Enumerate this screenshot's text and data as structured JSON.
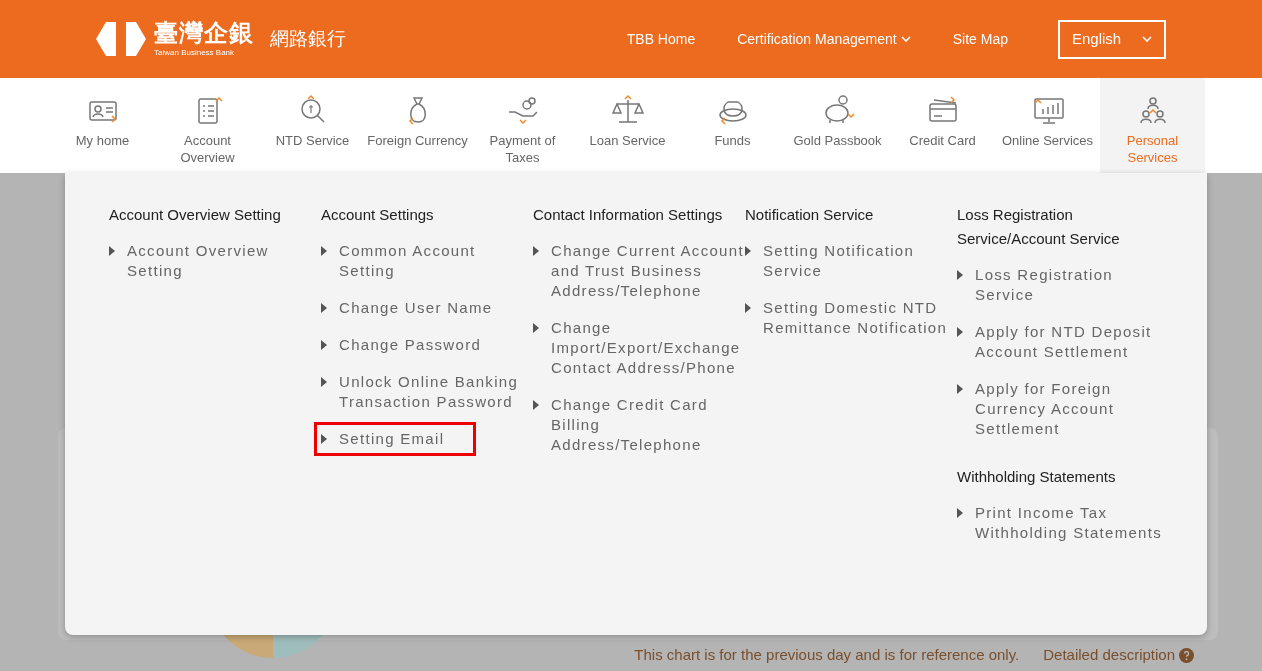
{
  "header": {
    "logo_name": "臺灣企銀",
    "logo_subtitle": "Taiwan Business Bank",
    "product_name": "網路銀行",
    "links": [
      {
        "label": "TBB Home",
        "dropdown": false
      },
      {
        "label": "Certification Management",
        "dropdown": true
      },
      {
        "label": "Site Map",
        "dropdown": false
      }
    ],
    "language": {
      "value": "English"
    }
  },
  "nav": [
    {
      "label": "My home",
      "selected": false
    },
    {
      "label": "Account Overview",
      "selected": false
    },
    {
      "label": "NTD Service",
      "selected": false
    },
    {
      "label": "Foreign Currency",
      "selected": false
    },
    {
      "label": "Payment of Taxes",
      "selected": false
    },
    {
      "label": "Loan Service",
      "selected": false
    },
    {
      "label": "Funds",
      "selected": false
    },
    {
      "label": "Gold Passbook",
      "selected": false
    },
    {
      "label": "Credit Card",
      "selected": false
    },
    {
      "label": "Online Services",
      "selected": false
    },
    {
      "label": "Personal Services",
      "selected": true
    }
  ],
  "menu_columns": [
    {
      "groups": [
        {
          "heading": "Account Overview Setting",
          "items": [
            {
              "label": "Account Overview Setting",
              "highlighted": false
            }
          ]
        }
      ]
    },
    {
      "groups": [
        {
          "heading": "Account Settings",
          "items": [
            {
              "label": "Common Account Setting",
              "highlighted": false
            },
            {
              "label": "Change User Name",
              "highlighted": false
            },
            {
              "label": "Change Password",
              "highlighted": false
            },
            {
              "label": "Unlock Online Banking Transaction Password",
              "highlighted": false
            },
            {
              "label": "Setting Email",
              "highlighted": true
            }
          ]
        }
      ]
    },
    {
      "groups": [
        {
          "heading": "Contact Information Settings",
          "items": [
            {
              "label": "Change Current Account and Trust Business Address/Telephone",
              "highlighted": false
            },
            {
              "label": "Change Import/Export/Exchange Contact Address/Phone",
              "highlighted": false
            },
            {
              "label": "Change Credit Card Billing Address/Telephone",
              "highlighted": false
            }
          ]
        }
      ]
    },
    {
      "groups": [
        {
          "heading": "Notification Service",
          "items": [
            {
              "label": "Setting Notification Service",
              "highlighted": false
            },
            {
              "label": "Setting Domestic NTD Remittance Notification",
              "highlighted": false
            }
          ]
        }
      ]
    },
    {
      "groups": [
        {
          "heading": "Loss Registration Service/Account Service",
          "items": [
            {
              "label": "Loss Registration Service",
              "highlighted": false
            },
            {
              "label": "Apply for NTD Deposit Account Settlement",
              "highlighted": false
            },
            {
              "label": "Apply for Foreign Currency Account Settlement",
              "highlighted": false
            }
          ]
        },
        {
          "heading": "Withholding Statements",
          "items": [
            {
              "label": "Print Income Tax Withholding Statements",
              "highlighted": false
            }
          ]
        }
      ]
    }
  ],
  "footer_note": {
    "text": "This chart is for the previous day and is for reference only.",
    "link": "Detailed description"
  }
}
